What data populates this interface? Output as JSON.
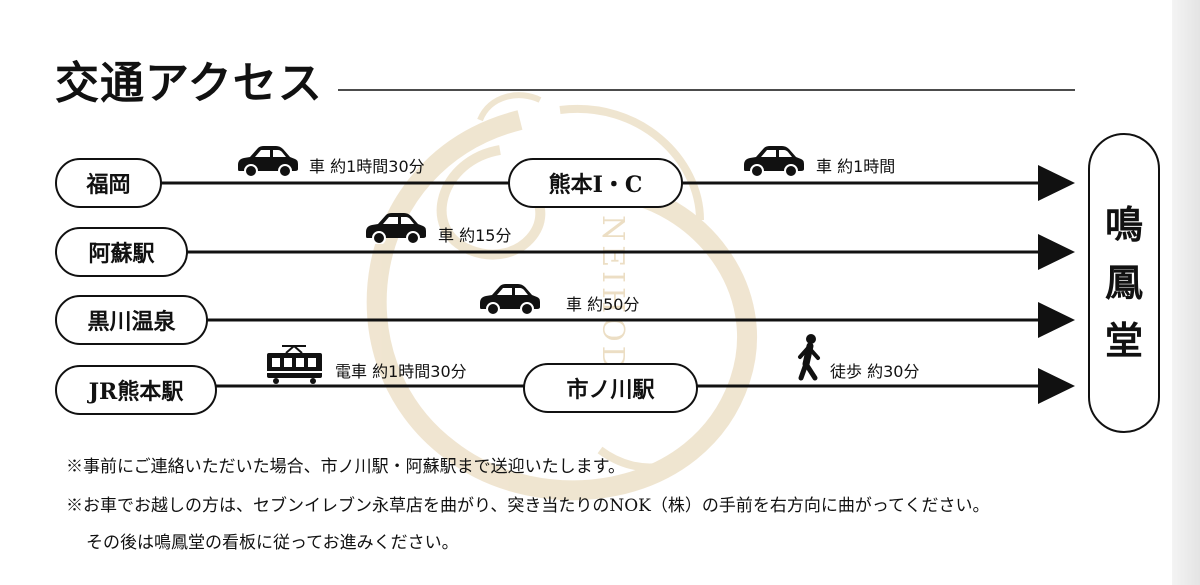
{
  "title": "交通アクセス",
  "destination": [
    "鳴",
    "鳳",
    "堂"
  ],
  "watermark_text": "NEIHODO",
  "stations": {
    "fukuoka": "福岡",
    "kumamoto_ic": "熊本I・C",
    "aso": "阿蘇駅",
    "kurokawa": "黒川温泉",
    "jr_kumamoto": "JR熊本駅",
    "ichinokawa": "市ノ川駅"
  },
  "routes": {
    "fukuoka_leg": "車 約1時間30分",
    "ic_leg": "車 約1時間",
    "aso_leg": "車 約15分",
    "kurokawa_leg": "車 約50分",
    "train_leg": "電車 約1時間30分",
    "walk_leg": "徒歩 約30分"
  },
  "icons": {
    "car": "car-icon",
    "train": "train-icon",
    "walk": "walking-person-icon"
  },
  "colors": {
    "ink": "#111111",
    "watermark_gold": "#c9a35a"
  },
  "notes": [
    "※事前にご連絡いただいた場合、市ノ川駅・阿蘇駅まで送迎いたします。",
    "※お車でお越しの方は、セブンイレブン永草店を曲がり、突き当たりのNOK（株）の手前を右方向に曲がってください。",
    "その後は鳴鳳堂の看板に従ってお進みください。"
  ]
}
